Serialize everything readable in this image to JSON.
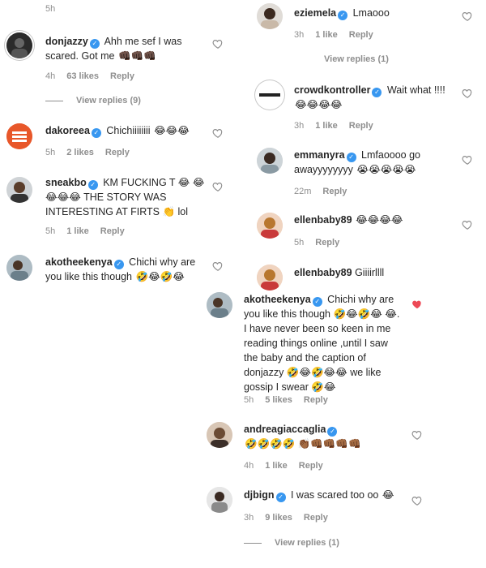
{
  "left": {
    "top_meta": "5h",
    "comments": [
      {
        "user": "donjazzy",
        "text": "Ahh me sef I was scared. Got me",
        "emoji": "👊🏿👊🏿👊🏿",
        "time": "4h",
        "likes": "63 likes",
        "reply": "Reply",
        "view_replies": "View replies (9)"
      },
      {
        "user": "dakoreea",
        "text": "Chichiiiiiiii",
        "emoji": "😂😂😂",
        "time": "5h",
        "likes": "2 likes",
        "reply": "Reply"
      },
      {
        "user": "sneakbo",
        "text": "KM FUCKING T 😂 😂😂😂😂 THE STORY WAS INTERESTING AT FIRTS 👏 lol",
        "emoji": "",
        "time": "5h",
        "likes": "1 like",
        "reply": "Reply"
      },
      {
        "user": "akotheekenya",
        "text": "Chichi why are you like this though",
        "emoji": "🤣😂🤣😂",
        "time": "",
        "likes": "",
        "reply": ""
      }
    ]
  },
  "right": {
    "comments": [
      {
        "user": "eziemela",
        "text": "Lmaooo",
        "time": "3h",
        "likes": "1 like",
        "reply": "Reply",
        "view_replies": "View replies (1)"
      },
      {
        "user": "crowdkontroller",
        "text": "Wait what !!!!",
        "emoji": "😂😂😂😂",
        "time": "3h",
        "likes": "1 like",
        "reply": "Reply",
        "avatar_text": "crowdkontroller"
      },
      {
        "user": "emmanyra",
        "text": "Lmfaoooo go awayyyyyyyy",
        "emoji": "😭😭😭😭😭",
        "time": "22m",
        "reply": "Reply"
      },
      {
        "user": "ellenbaby89",
        "text": "",
        "emoji": "😂😂😂😂",
        "time": "5h",
        "reply": "Reply"
      },
      {
        "user": "ellenbaby89",
        "text": "Giiiirllll",
        "time": ""
      },
      {
        "user": "akotheekenya",
        "text": "Chichi why are you like this though 🤣😂🤣😂 😂. I have never been so keen in me reading things online ,until I saw the baby and the caption of donjazzy 🤣😂🤣😂😂 we like gossip I swear 🤣😂",
        "time": "5h",
        "likes": "5 likes",
        "reply": "Reply"
      },
      {
        "user": "andreagiaccaglia",
        "text": "",
        "emoji": "🤣🤣🤣🤣 👏🏾👊🏾👊🏾👊🏾👊🏾",
        "time": "4h",
        "likes": "1 like",
        "reply": "Reply"
      },
      {
        "user": "djbign",
        "text": "I was scared too oo",
        "emoji": "😂",
        "time": "3h",
        "likes": "9 likes",
        "reply": "Reply",
        "view_replies": "View replies (1)"
      }
    ]
  },
  "colors": {
    "verified": "#3897f0",
    "liked_heart": "#ed4956",
    "meta": "#8e8e8e"
  }
}
